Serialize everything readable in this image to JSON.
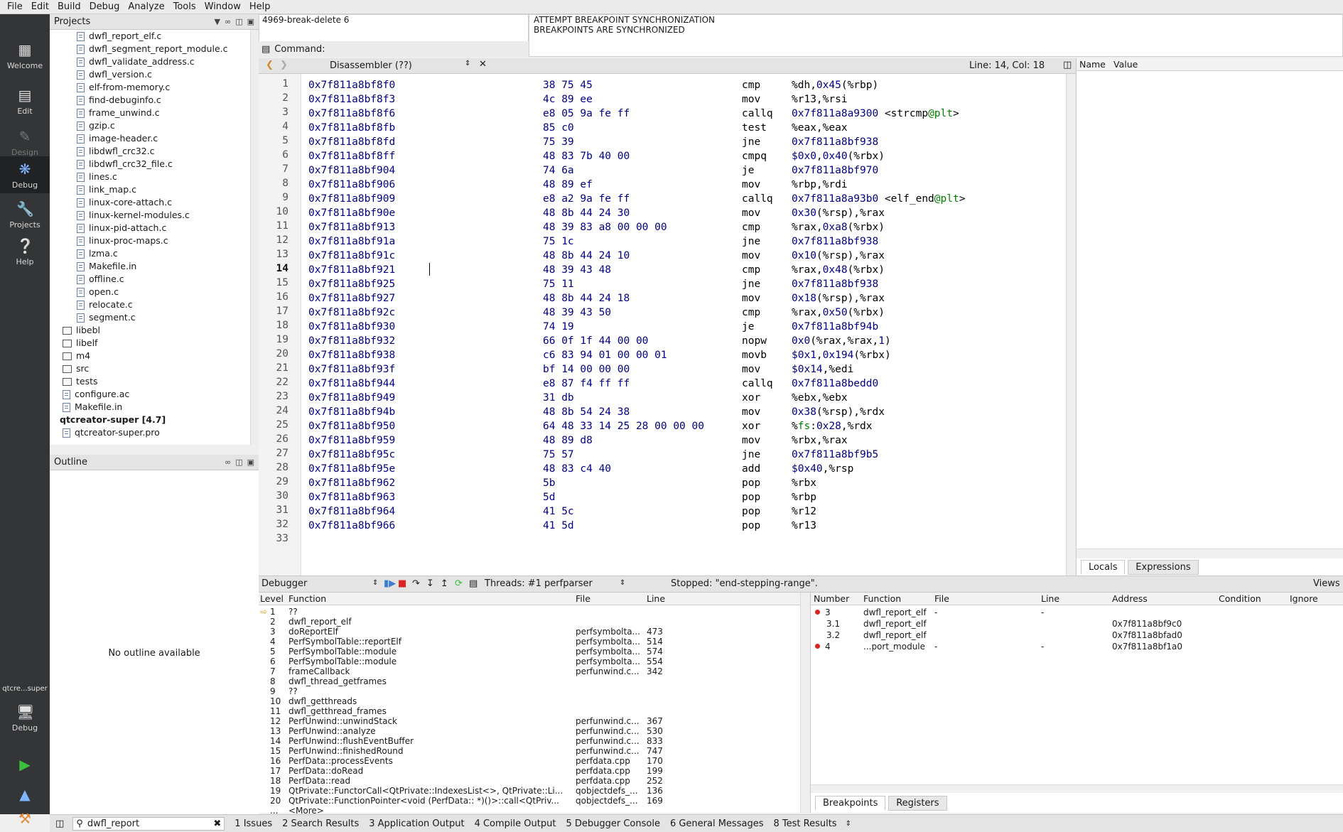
{
  "menu": [
    "File",
    "Edit",
    "Build",
    "Debug",
    "Analyze",
    "Tools",
    "Window",
    "Help"
  ],
  "modes": {
    "welcome": "Welcome",
    "edit": "Edit",
    "design": "Design",
    "debug": "Debug",
    "projects": "Projects",
    "help": "Help",
    "kit_project": "qtcre...super",
    "kit_mode": "Debug"
  },
  "projects": {
    "title": "Projects",
    "files": [
      "dwfl_report_elf.c",
      "dwfl_segment_report_module.c",
      "dwfl_validate_address.c",
      "dwfl_version.c",
      "elf-from-memory.c",
      "find-debuginfo.c",
      "frame_unwind.c",
      "gzip.c",
      "image-header.c",
      "libdwfl_crc32.c",
      "libdwfl_crc32_file.c",
      "lines.c",
      "link_map.c",
      "linux-core-attach.c",
      "linux-kernel-modules.c",
      "linux-pid-attach.c",
      "linux-proc-maps.c",
      "lzma.c",
      "Makefile.in",
      "offline.c",
      "open.c",
      "relocate.c",
      "segment.c"
    ],
    "folders": [
      "libebl",
      "libelf",
      "m4",
      "src",
      "tests"
    ],
    "root_files": [
      "configure.ac",
      "Makefile.in"
    ],
    "project": "qtcreator-super [4.7]",
    "project_file": "qtcreator-super.pro"
  },
  "outline": {
    "title": "Outline",
    "empty": "No outline available"
  },
  "log_left": "4969-break-delete 6",
  "log_right": [
    "ATTEMPT BREAKPOINT SYNCHRONIZATION",
    "BREAKPOINTS ARE SYNCHRONIZED"
  ],
  "command_label": "Command:",
  "editor": {
    "doc": "Disassembler (??)",
    "position": "Line: 14, Col: 18"
  },
  "disasm": [
    [
      "0x7f811a8bf8f0",
      "38 75 45",
      "cmp",
      "%dh,0x45(%rbp)"
    ],
    [
      "0x7f811a8bf8f3",
      "4c 89 ee",
      "mov",
      "%r13,%rsi"
    ],
    [
      "0x7f811a8bf8f6",
      "e8 05 9a fe ff",
      "callq",
      "0x7f811a8a9300 <strcmp@plt>"
    ],
    [
      "0x7f811a8bf8fb",
      "85 c0",
      "test",
      "%eax,%eax"
    ],
    [
      "0x7f811a8bf8fd",
      "75 39",
      "jne",
      "0x7f811a8bf938"
    ],
    [
      "0x7f811a8bf8ff",
      "48 83 7b 40 00",
      "cmpq",
      "$0x0,0x40(%rbx)"
    ],
    [
      "0x7f811a8bf904",
      "74 6a",
      "je",
      "0x7f811a8bf970"
    ],
    [
      "0x7f811a8bf906",
      "48 89 ef",
      "mov",
      "%rbp,%rdi"
    ],
    [
      "0x7f811a8bf909",
      "e8 a2 9a fe ff",
      "callq",
      "0x7f811a8a93b0 <elf_end@plt>"
    ],
    [
      "0x7f811a8bf90e",
      "48 8b 44 24 30",
      "mov",
      "0x30(%rsp),%rax"
    ],
    [
      "0x7f811a8bf913",
      "48 39 83 a8 00 00 00",
      "cmp",
      "%rax,0xa8(%rbx)"
    ],
    [
      "0x7f811a8bf91a",
      "75 1c",
      "jne",
      "0x7f811a8bf938"
    ],
    [
      "0x7f811a8bf91c",
      "48 8b 44 24 10",
      "mov",
      "0x10(%rsp),%rax"
    ],
    [
      "0x7f811a8bf921",
      "48 39 43 48",
      "cmp",
      "%rax,0x48(%rbx)"
    ],
    [
      "0x7f811a8bf925",
      "75 11",
      "jne",
      "0x7f811a8bf938"
    ],
    [
      "0x7f811a8bf927",
      "48 8b 44 24 18",
      "mov",
      "0x18(%rsp),%rax"
    ],
    [
      "0x7f811a8bf92c",
      "48 39 43 50",
      "cmp",
      "%rax,0x50(%rbx)"
    ],
    [
      "0x7f811a8bf930",
      "74 19",
      "je",
      "0x7f811a8bf94b"
    ],
    [
      "0x7f811a8bf932",
      "66 0f 1f 44 00 00",
      "nopw",
      "0x0(%rax,%rax,1)"
    ],
    [
      "0x7f811a8bf938",
      "c6 83 94 01 00 00 01",
      "movb",
      "$0x1,0x194(%rbx)"
    ],
    [
      "0x7f811a8bf93f",
      "bf 14 00 00 00",
      "mov",
      "$0x14,%edi"
    ],
    [
      "0x7f811a8bf944",
      "e8 87 f4 ff ff",
      "callq",
      "0x7f811a8bedd0"
    ],
    [
      "0x7f811a8bf949",
      "31 db",
      "xor",
      "%ebx,%ebx"
    ],
    [
      "0x7f811a8bf94b",
      "48 8b 54 24 38",
      "mov",
      "0x38(%rsp),%rdx"
    ],
    [
      "0x7f811a8bf950",
      "64 48 33 14 25 28 00 00 00",
      "xor",
      "%fs:0x28,%rdx"
    ],
    [
      "0x7f811a8bf959",
      "48 89 d8",
      "mov",
      "%rbx,%rax"
    ],
    [
      "0x7f811a8bf95c",
      "75 57",
      "jne",
      "0x7f811a8bf9b5"
    ],
    [
      "0x7f811a8bf95e",
      "48 83 c4 40",
      "add",
      "$0x40,%rsp"
    ],
    [
      "0x7f811a8bf962",
      "5b",
      "pop",
      "%rbx"
    ],
    [
      "0x7f811a8bf963",
      "5d",
      "pop",
      "%rbp"
    ],
    [
      "0x7f811a8bf964",
      "41 5c",
      "pop",
      "%r12"
    ],
    [
      "0x7f811a8bf966",
      "41 5d",
      "pop",
      "%r13"
    ]
  ],
  "locals": {
    "col_name": "Name",
    "col_value": "Value",
    "tab_locals": "Locals",
    "tab_expressions": "Expressions"
  },
  "debugger": {
    "label": "Debugger",
    "threads": "Threads: #1 perfparser",
    "state": "Stopped: \"end-stepping-range\".",
    "views": "Views"
  },
  "stack_headers": [
    "Level",
    "Function",
    "File",
    "Line"
  ],
  "stack": [
    [
      "1",
      "??",
      "",
      ""
    ],
    [
      "2",
      "dwfl_report_elf",
      "",
      ""
    ],
    [
      "3",
      "doReportElf",
      "perfsymbolta...",
      "473"
    ],
    [
      "4",
      "PerfSymbolTable::reportElf",
      "perfsymbolta...",
      "514"
    ],
    [
      "5",
      "PerfSymbolTable::module",
      "perfsymbolta...",
      "574"
    ],
    [
      "6",
      "PerfSymbolTable::module",
      "perfsymbolta...",
      "554"
    ],
    [
      "7",
      "frameCallback",
      "perfunwind.c...",
      "342"
    ],
    [
      "8",
      "dwfl_thread_getframes",
      "",
      ""
    ],
    [
      "9",
      "??",
      "",
      ""
    ],
    [
      "10",
      "dwfl_getthreads",
      "",
      ""
    ],
    [
      "11",
      "dwfl_getthread_frames",
      "",
      ""
    ],
    [
      "12",
      "PerfUnwind::unwindStack",
      "perfunwind.c...",
      "367"
    ],
    [
      "13",
      "PerfUnwind::analyze",
      "perfunwind.c...",
      "530"
    ],
    [
      "14",
      "PerfUnwind::flushEventBuffer",
      "perfunwind.c...",
      "833"
    ],
    [
      "15",
      "PerfUnwind::finishedRound",
      "perfunwind.c...",
      "747"
    ],
    [
      "16",
      "PerfData::processEvents",
      "perfdata.cpp",
      "170"
    ],
    [
      "17",
      "PerfData::doRead",
      "perfdata.cpp",
      "199"
    ],
    [
      "18",
      "PerfData::read",
      "perfdata.cpp",
      "252"
    ],
    [
      "19",
      "QtPrivate::FunctorCall<QtPrivate::IndexesList<>, QtPrivate::Li...",
      "qobjectdefs_...",
      "136"
    ],
    [
      "20",
      "QtPrivate::FunctionPointer<void (PerfData:: *)()>::call<QtPriv...",
      "qobjectdefs_...",
      "169"
    ],
    [
      "...",
      "<More>",
      "",
      ""
    ]
  ],
  "bp_headers": [
    "Number",
    "Function",
    "File",
    "Line",
    "Address",
    "Condition",
    "Ignore"
  ],
  "breakpoints": [
    {
      "num": "3",
      "func": "dwfl_report_elf",
      "file": "-",
      "line": "-",
      "addr": "",
      "dot": true
    },
    {
      "num": "3.1",
      "func": "dwfl_report_elf",
      "file": "",
      "line": "",
      "addr": "0x7f811a8bf9c0",
      "dot": false
    },
    {
      "num": "3.2",
      "func": "dwfl_report_elf",
      "file": "",
      "line": "",
      "addr": "0x7f811a8bfad0",
      "dot": false
    },
    {
      "num": "4",
      "func": "...port_module",
      "file": "-",
      "line": "-",
      "addr": "0x7f811a8bf1a0",
      "dot": true
    }
  ],
  "bp_tabs": [
    "Breakpoints",
    "Registers"
  ],
  "search_value": "dwfl_report",
  "output_tabs": [
    "1  Issues",
    "2  Search Results",
    "3  Application Output",
    "4  Compile Output",
    "5  Debugger Console",
    "6  General Messages",
    "8  Test Results"
  ]
}
